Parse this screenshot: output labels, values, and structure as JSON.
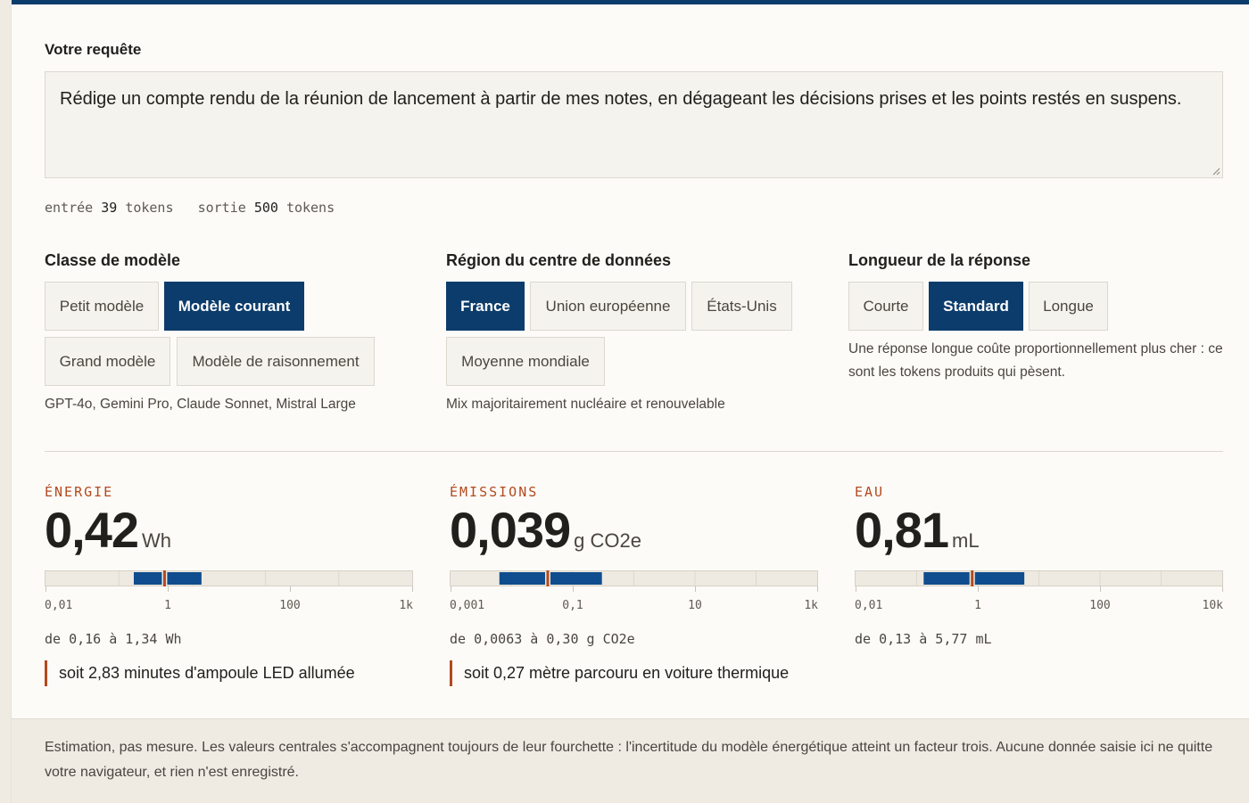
{
  "request": {
    "label": "Votre requête",
    "text": "Rédige un compte rendu de la réunion de lancement à partir de mes notes, en dégageant les décisions prises et les points restés en suspens."
  },
  "tokens": {
    "input_label": "entrée",
    "input_value": "39",
    "input_unit": "tokens",
    "output_label": "sortie",
    "output_value": "500",
    "output_unit": "tokens"
  },
  "model_class": {
    "title": "Classe de modèle",
    "options": [
      "Petit modèle",
      "Modèle courant",
      "Grand modèle",
      "Modèle de raisonnement"
    ],
    "selected": "Modèle courant",
    "hint": "GPT-4o, Gemini Pro, Claude Sonnet, Mistral Large"
  },
  "region": {
    "title": "Région du centre de données",
    "options": [
      "France",
      "Union européenne",
      "États-Unis",
      "Moyenne mondiale"
    ],
    "selected": "France",
    "hint": "Mix majoritairement nucléaire et renouvelable"
  },
  "length": {
    "title": "Longueur de la réponse",
    "options": [
      "Courte",
      "Standard",
      "Longue"
    ],
    "selected": "Standard",
    "hint": "Une réponse longue coûte proportionnellement plus cher : ce sont les tokens produits qui pèsent."
  },
  "metrics": {
    "energy": {
      "label": "ÉNERGIE",
      "value": "0,42",
      "unit": "Wh",
      "scale_min": 0.01,
      "scale_max": 1000,
      "central": 0.42,
      "low": 0.16,
      "high": 1.34,
      "ticks": [
        "0,01",
        "1",
        "100",
        "1k"
      ],
      "range_text": "de 0,16 à 1,34 Wh",
      "equivalent": "soit 2,83 minutes d'ampoule LED allumée"
    },
    "emissions": {
      "label": "ÉMISSIONS",
      "value": "0,039",
      "unit": "g CO2e",
      "scale_min": 0.001,
      "scale_max": 1000,
      "central": 0.039,
      "low": 0.0063,
      "high": 0.3,
      "ticks": [
        "0,001",
        "0,1",
        "10",
        "1k"
      ],
      "range_text": "de 0,0063 à 0,30 g CO2e",
      "equivalent": "soit 0,27 mètre parcouru en voiture thermique"
    },
    "water": {
      "label": "EAU",
      "value": "0,81",
      "unit": "mL",
      "scale_min": 0.01,
      "scale_max": 10000,
      "central": 0.81,
      "low": 0.13,
      "high": 5.77,
      "ticks": [
        "0,01",
        "1",
        "100",
        "10k"
      ],
      "range_text": "de 0,13 à 5,77 mL"
    }
  },
  "footer": {
    "text": "Estimation, pas mesure. Les valeurs centrales s'accompagnent toujours de leur fourchette : l'incertitude du modèle énergétique atteint un facteur trois. Aucune donnée saisie ici ne quitte votre navigateur, et rien n'est enregistré."
  },
  "colors": {
    "accent_blue": "#0c3c6b",
    "bar_blue": "#0f4d8e",
    "accent_rust": "#b34a1e",
    "background": "#fcfbf8"
  }
}
